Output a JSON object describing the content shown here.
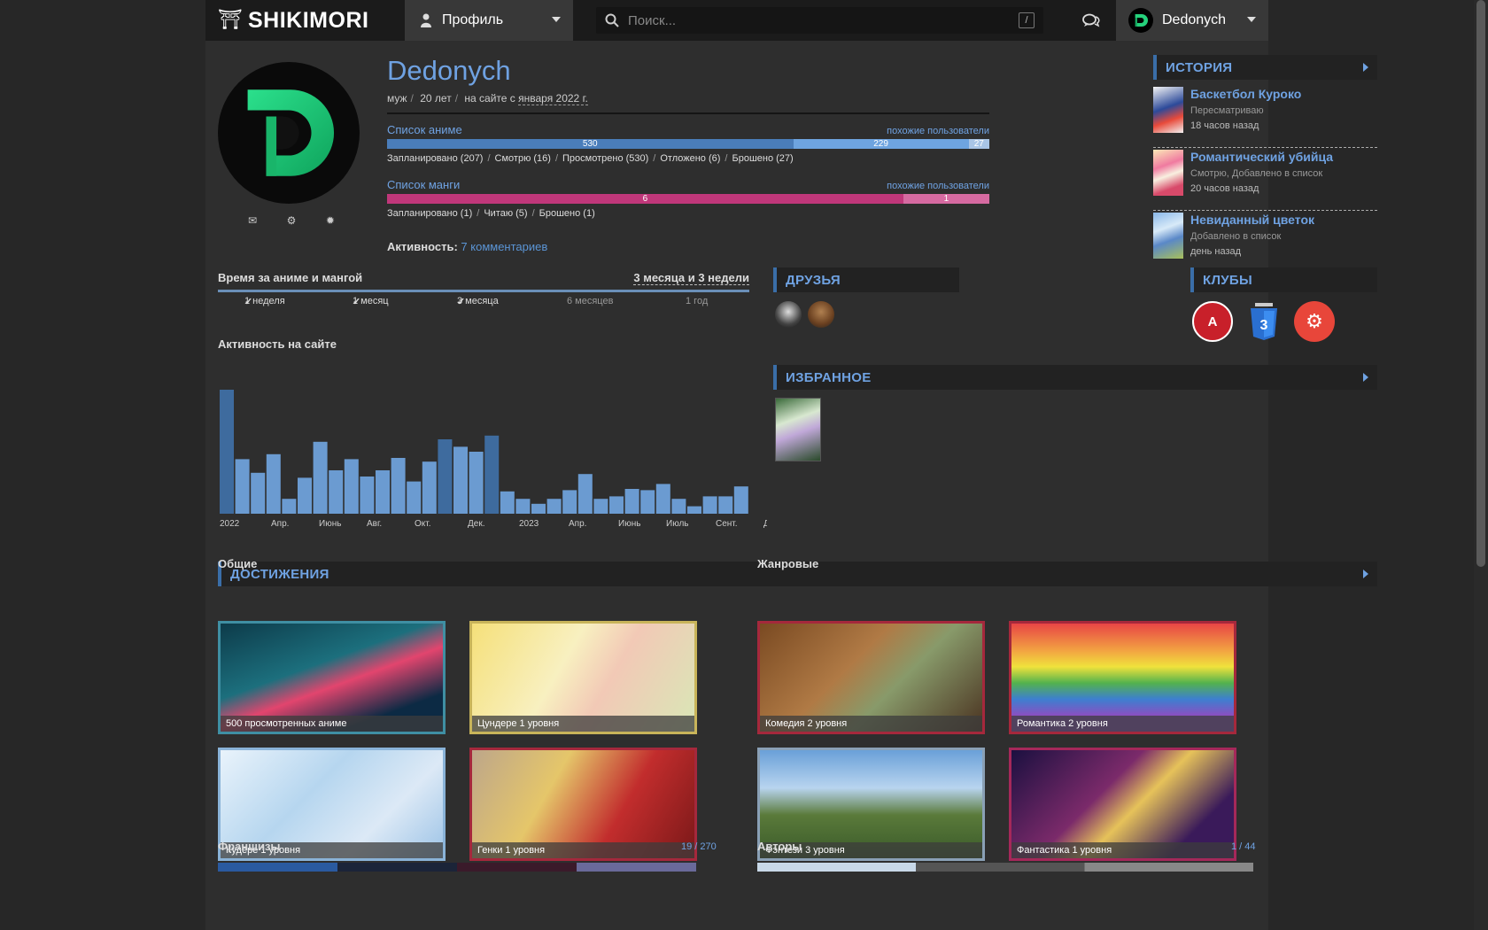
{
  "nav": {
    "logo_text": "SHIKIMORI",
    "profile_label": "Профиль",
    "search_placeholder": "Поиск...",
    "search_key": "/",
    "username": "Dedonych"
  },
  "profile": {
    "name": "Dedonych",
    "gender": "муж",
    "age": "20 лет",
    "since_prefix": "на сайте с",
    "since_date": "января 2022 г.",
    "activity_label": "Активность:",
    "activity_link": "7 комментариев"
  },
  "anime_list": {
    "title": "Список аниме",
    "similar": "похожие пользователи",
    "segments": [
      {
        "value": 530,
        "label": "530",
        "color": "#4a7dba"
      },
      {
        "value": 229,
        "label": "229",
        "color": "#6ea4e0"
      },
      {
        "value": 27,
        "label": "27",
        "color": "#a9c5e6"
      }
    ],
    "stats": [
      {
        "label": "Запланировано",
        "count": "207"
      },
      {
        "label": "Смотрю",
        "count": "16"
      },
      {
        "label": "Просмотрено",
        "count": "530"
      },
      {
        "label": "Отложено",
        "count": "6"
      },
      {
        "label": "Брошено",
        "count": "27"
      }
    ]
  },
  "manga_list": {
    "title": "Список манги",
    "similar": "похожие пользователи",
    "segments": [
      {
        "value": 6,
        "label": "6",
        "color": "#c0377a"
      },
      {
        "value": 1,
        "label": "1",
        "color": "#d66aa1"
      }
    ],
    "stats": [
      {
        "label": "Запланировано",
        "count": "1"
      },
      {
        "label": "Читаю",
        "count": "5"
      },
      {
        "label": "Брошено",
        "count": "1"
      }
    ]
  },
  "history": {
    "title": "ИСТОРИЯ",
    "items": [
      {
        "title": "Баскетбол Куроко",
        "status": "Пересматриваю",
        "time": "18 часов назад"
      },
      {
        "title": "Романтический убийца",
        "status": "Смотрю, Добавлено в список",
        "time": "20 часов назад"
      },
      {
        "title": "Невиданный цветок",
        "status": "Добавлено в список",
        "time": "день назад"
      }
    ]
  },
  "time_spent": {
    "title": "Время за аниме и мангой",
    "value": "3 месяца и 3 недели",
    "marks": [
      {
        "label": "1 неделя",
        "done": true
      },
      {
        "label": "1 месяц",
        "done": true
      },
      {
        "label": "3 месяца",
        "done": true
      },
      {
        "label": "6 месяцев",
        "done": false
      },
      {
        "label": "1 год",
        "done": false
      }
    ]
  },
  "site_activity": {
    "title": "Активность на сайте"
  },
  "chart_data": {
    "type": "bar",
    "values": [
      100,
      44,
      33,
      48,
      12,
      29,
      58,
      35,
      44,
      30,
      35,
      45,
      26,
      42,
      60,
      54,
      50,
      63,
      18,
      12,
      8,
      12,
      19,
      32,
      12,
      14,
      20,
      19,
      24,
      12,
      6,
      14,
      14,
      22
    ],
    "dark_indices": [
      0,
      14,
      17
    ],
    "tick_labels": [
      "2022",
      "Апр.",
      "Июнь",
      "Авг.",
      "Окт.",
      "Дек.",
      "2023",
      "Апр.",
      "Июнь",
      "Июль",
      "Сент.",
      "Дек."
    ],
    "color": "#6b9bd1",
    "dark_color": "#3e6b9e"
  },
  "friends": {
    "title": "ДРУЗЬЯ"
  },
  "clubs": {
    "title": "КЛУБЫ"
  },
  "favourites": {
    "title": "ИЗБРАННОЕ"
  },
  "achievements": {
    "title": "ДОСТИЖЕНИЯ",
    "general_title": "Общие",
    "genre_title": "Жанровые",
    "general": [
      {
        "label": "500 просмотренных аниме",
        "border": "#3f8fa3",
        "bg": "linear-gradient(160deg,#0d3b4a,#1c6f7d 40%,#e2456e 55%,#0c2a44 80%)"
      },
      {
        "label": "Цундере 1 уровня",
        "border": "#c8b45a",
        "bg": "linear-gradient(120deg,#f5e07a,#f8f0c0 40%,#f2c9b6 60%,#d9e7b6)"
      },
      {
        "label": "Кудере 1 уровня",
        "border": "#8ab3d8",
        "bg": "linear-gradient(135deg,#e9f3fb,#b6d6ef 40%,#dce9f6 70%,#9cc3e6)"
      },
      {
        "label": "Генки 1 уровня",
        "border": "#a5283c",
        "bg": "linear-gradient(120deg,#bda68a,#e5c66a 35%,#c22d2d 65%,#7a1818)"
      }
    ],
    "genre": [
      {
        "label": "Комедия 2 уровня",
        "border": "#a5283c",
        "bg": "linear-gradient(135deg,#7a4a22,#b07a45 40%,#889a6a 60%,#4a3220)"
      },
      {
        "label": "Романтика 2 уровня",
        "border": "#a5283c",
        "bg": "linear-gradient(180deg,#e84545,#f2a342 25%,#f0e23c 40%,#53b24d 55%,#3d7fd0 70%,#8a4fc1 85%)"
      },
      {
        "label": "Фэнтези 3 уровня",
        "border": "#8aa0b6",
        "bg": "linear-gradient(180deg,#6aa0d8,#b8d4ef 35%,#5a7a3a 60%,#3a5a2a)"
      },
      {
        "label": "Фантастика 1 уровня",
        "border": "#a5285a",
        "bg": "linear-gradient(135deg,#1b1040,#7b2a6a 40%,#e6c25a 55%,#3a1a5a 80%)"
      }
    ]
  },
  "franchises": {
    "title": "Франшизы",
    "count": "19 / 270"
  },
  "authors": {
    "title": "Авторы",
    "count": "1 / 44"
  }
}
